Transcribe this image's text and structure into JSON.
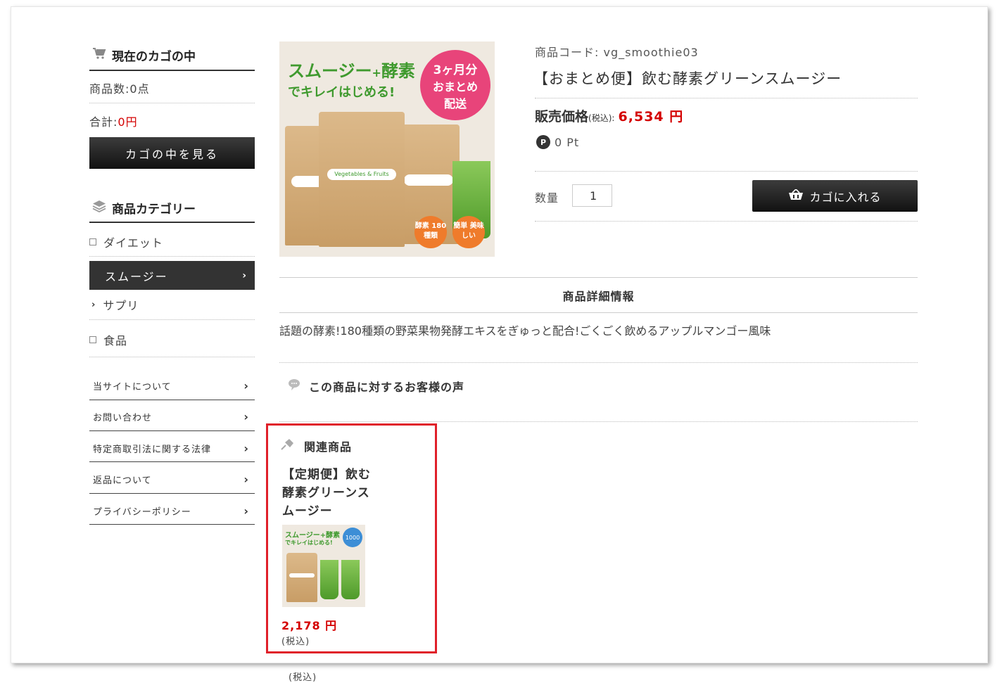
{
  "sidebar": {
    "cart": {
      "title": "現在のカゴの中",
      "count_label": "商品数:0点",
      "total_label": "合計:",
      "total_value": "0円",
      "view_button": "カゴの中を見る"
    },
    "category": {
      "title": "商品カテゴリー",
      "items": [
        {
          "label": "ダイエット"
        },
        {
          "label": "スムージー"
        },
        {
          "label": "サプリ"
        },
        {
          "label": "食品"
        }
      ]
    },
    "links": [
      {
        "label": "当サイトについて"
      },
      {
        "label": "お問い合わせ"
      },
      {
        "label": "特定商取引法に関する法律"
      },
      {
        "label": "返品について"
      },
      {
        "label": "プライバシーポリシー"
      }
    ]
  },
  "product": {
    "code_label": "商品コード:",
    "code_value": "vg_smoothie03",
    "title": "【おまとめ便】飲む酵素グリーンスムージー",
    "price_label": "販売価格",
    "price_tax": "(税込):",
    "price_value": "6,534 円",
    "points": "0 Pt",
    "points_icon_letter": "P",
    "qty_label": "数量",
    "qty_value": "1",
    "add_to_cart": "カゴに入れる",
    "image_text": {
      "headline1": "スムージー",
      "plus": "+",
      "headline2": "酵素",
      "headline3": "でキレイはじめる!",
      "burst_line1": "3ヶ月分",
      "burst_line2": "おまとめ",
      "burst_line3": "配送",
      "badge1": "酵素 180種類",
      "badge2": "簡単 美味しい",
      "package_label": "Vegetables & Fruits"
    }
  },
  "details": {
    "heading": "商品詳細情報",
    "description": "話題の酵素!180種類の野菜果物発酵エキスをぎゅっと配合!ごくごく飲めるアップルマンゴー風味"
  },
  "reviews": {
    "heading": "この商品に対するお客様の声"
  },
  "related": {
    "heading": "関連商品",
    "item_title_line1": "【定期便】飲む",
    "item_title_line2": "酵素グリーンス",
    "item_title_line3": "ムージー",
    "price": "2,178 円",
    "tax_note": "(税込)",
    "thumb_text": {
      "headline": "スムージー+酵素",
      "sub": "でキレイはじめる!",
      "badge": "1000"
    }
  },
  "overflow_tax_note": "(税込)",
  "colors": {
    "accent_red": "#d40000",
    "highlight_border": "#e0202a",
    "button_dark": "#222222"
  }
}
